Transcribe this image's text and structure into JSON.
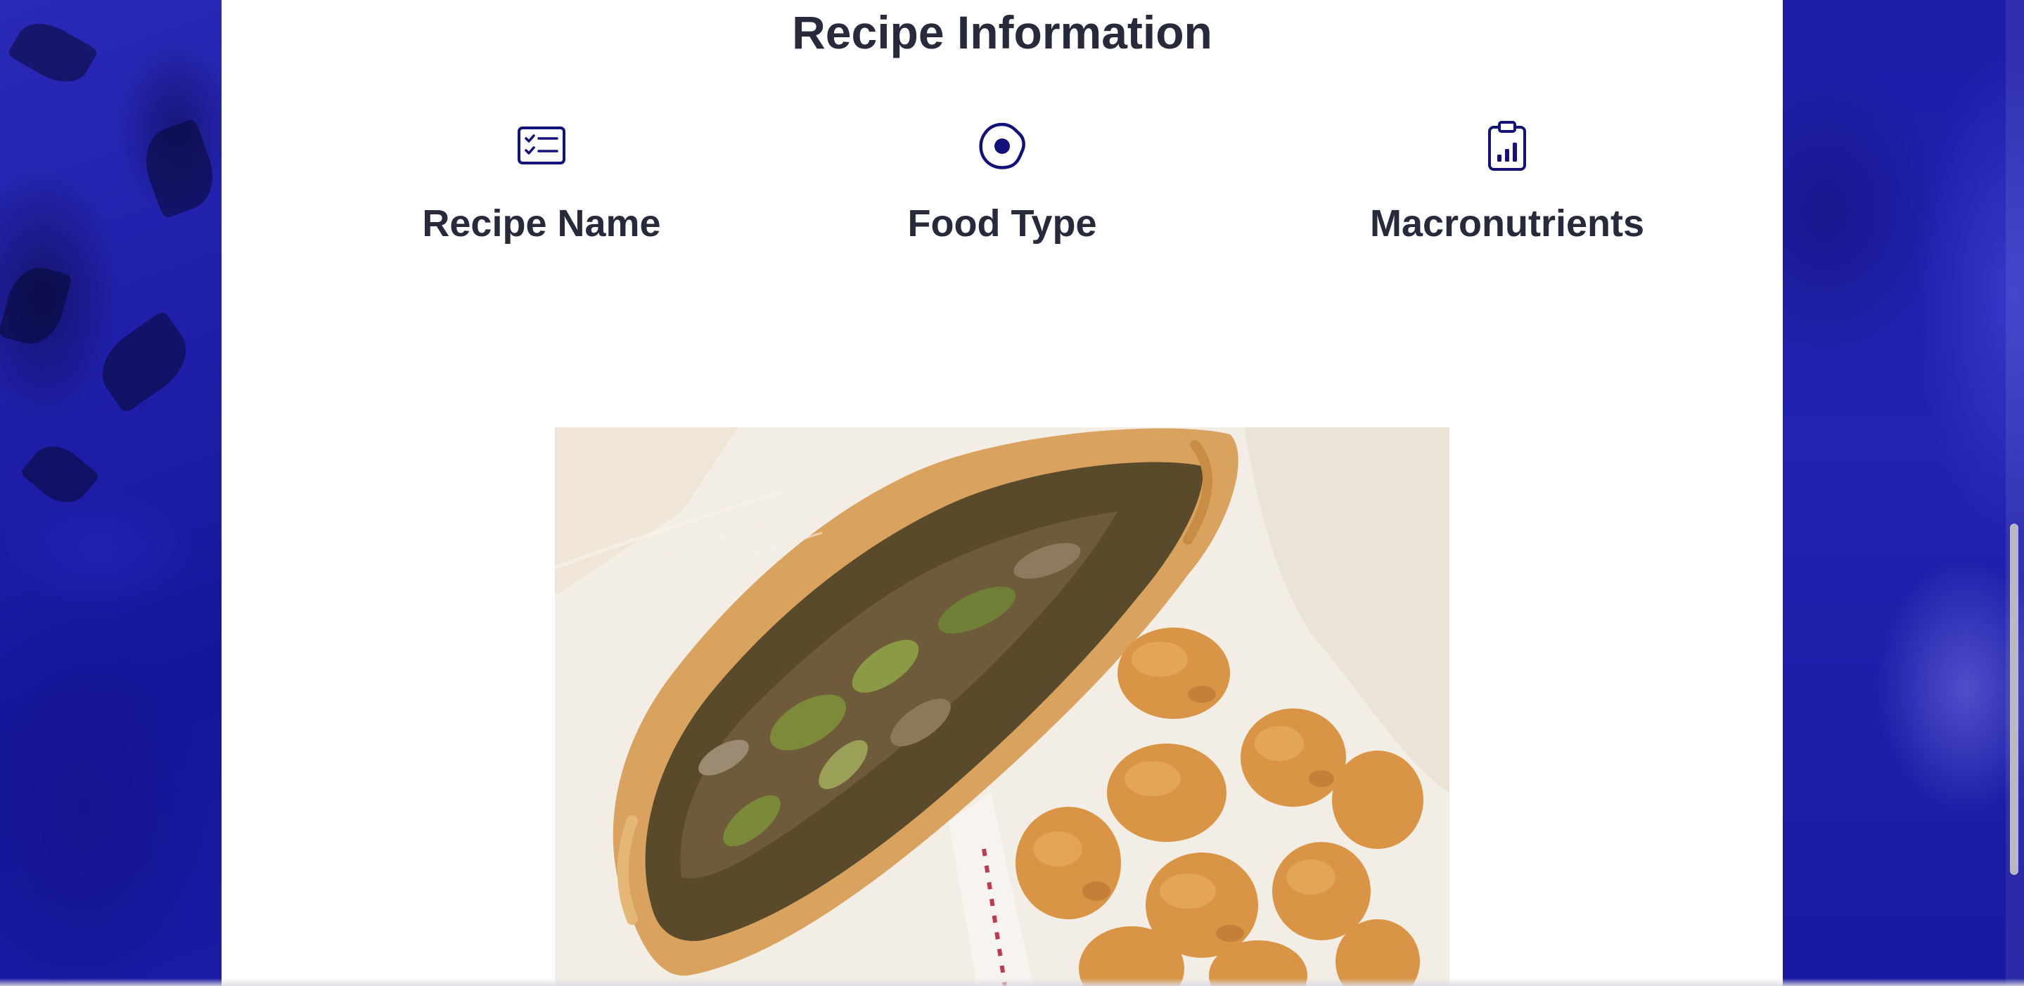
{
  "section": {
    "title": "Recipe Information"
  },
  "features": [
    {
      "label": "Recipe Name",
      "icon": "checklist-card-icon"
    },
    {
      "label": "Food Type",
      "icon": "fried-egg-icon"
    },
    {
      "label": "Macronutrients",
      "icon": "clipboard-chart-icon"
    }
  ],
  "photo": {
    "subject": "food-photo"
  },
  "colors": {
    "accent": "#12127a",
    "heading": "#262a3a",
    "background_side": "#1b1ba6",
    "content_bg": "#ffffff"
  }
}
